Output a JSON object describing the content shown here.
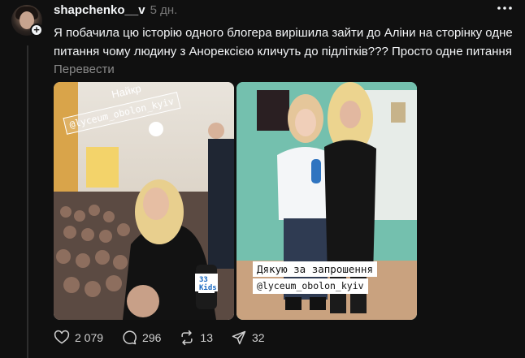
{
  "post": {
    "username": "shapchenko__v",
    "time": "5 дн.",
    "text": "Я побачила цю історію одного блогера вирішила зайти до Аліни на сторінку одне питання чому людину з Анорексією кличуть до підлітків??? Просто одне питання",
    "translate_label": "Перевести"
  },
  "media": [
    {
      "overlay_top": "Найкр",
      "overlay_top_tag": "@lyceum_obolon_kyiv",
      "mic_label": "33 Kids"
    },
    {
      "caption": "Дякую за запрошення",
      "tag": "@lyceum_obolon_kyiv"
    }
  ],
  "actions": {
    "likes": "2 079",
    "comments": "296",
    "reposts": "13",
    "shares": "32"
  },
  "icons": [
    "heart-icon",
    "comment-icon",
    "repost-icon",
    "share-icon",
    "more-icon",
    "plus-icon"
  ]
}
